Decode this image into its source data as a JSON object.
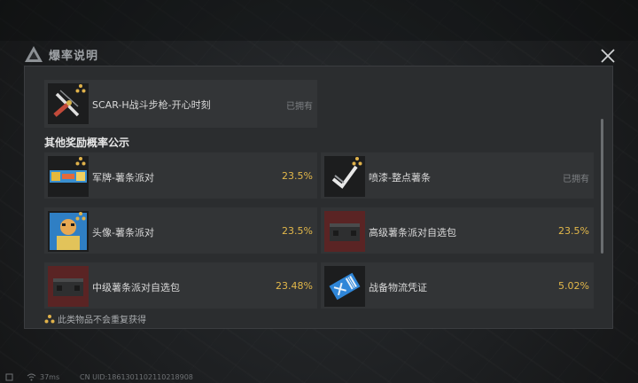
{
  "modal": {
    "title": "爆率说明"
  },
  "featured": {
    "name": "SCAR-H战斗步枪-开心时刻",
    "status": "已拥有",
    "thumb_icon": "knife-icon"
  },
  "section": {
    "title": "其他奖励概率公示"
  },
  "rewards": [
    {
      "name": "军牌-薯条派对",
      "value": "23.5%",
      "thumb_icon": "dog-tag-icon"
    },
    {
      "name": "喷漆-整点薯条",
      "value": "已拥有",
      "thumb_icon": "spray-icon"
    },
    {
      "name": "头像-薯条派对",
      "value": "23.5%",
      "thumb_icon": "avatar-icon"
    },
    {
      "name": "高级薯条派对自选包",
      "value": "23.5%",
      "thumb_icon": "supply-crate-icon"
    },
    {
      "name": "中级薯条派对自选包",
      "value": "23.48%",
      "thumb_icon": "supply-crate-icon"
    },
    {
      "name": "战备物流凭证",
      "value": "5.02%",
      "thumb_icon": "ticket-icon"
    }
  ],
  "footnote": {
    "text": "此类物品不会重复获得"
  },
  "status_bar": {
    "ping": "37ms",
    "uid": "CN UID:1861301102110218908"
  },
  "colors": {
    "accent_value": "#e3b84a",
    "panel": "#2b2d2f",
    "card": "#323436",
    "badge": "#e0b24a"
  }
}
